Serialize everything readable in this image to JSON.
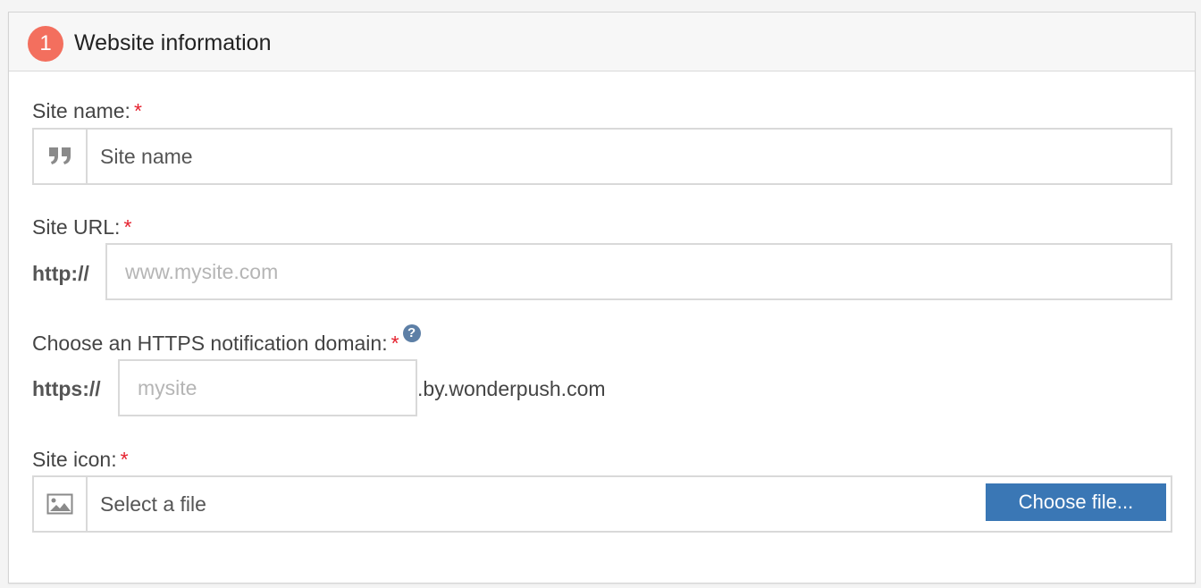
{
  "panel": {
    "step_number": "1",
    "title": "Website information"
  },
  "site_name": {
    "label": "Site name:",
    "required_mark": "*",
    "icon": "quote-icon",
    "placeholder": "Site name"
  },
  "site_url": {
    "label": "Site URL:",
    "required_mark": "*",
    "prefix": "http://",
    "placeholder": "www.mysite.com"
  },
  "https_domain": {
    "label": "Choose an HTTPS notification domain:",
    "required_mark": "*",
    "help_icon": "question-circle-icon",
    "help_glyph": "?",
    "prefix": "https://",
    "placeholder": "mysite",
    "suffix": ".by.wonderpush.com"
  },
  "site_icon": {
    "label": "Site icon:",
    "required_mark": "*",
    "icon": "image-icon",
    "file_text": "Select a file",
    "button_label": "Choose file..."
  },
  "colors": {
    "accent_badge": "#f36f5e",
    "button": "#3a77b5",
    "required": "#e5212e",
    "help": "#5d7fa6"
  }
}
